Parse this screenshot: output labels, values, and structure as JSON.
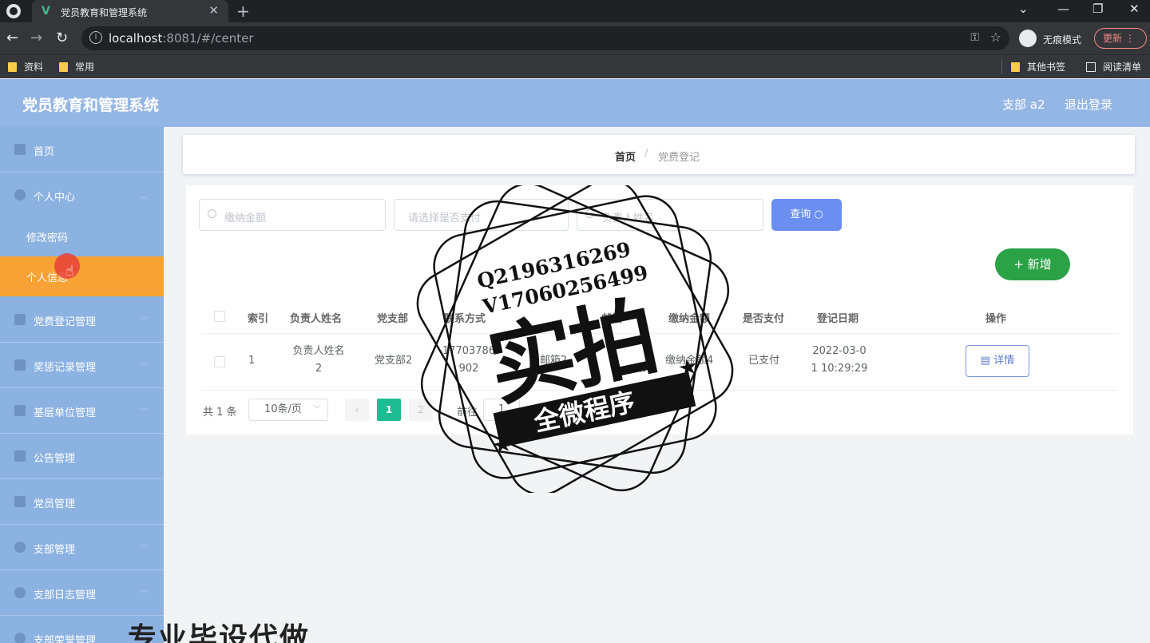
{
  "browser": {
    "tab_title": "党员教育和管理系统",
    "tab_icon": "V",
    "url_host": "localhost",
    "url_rest": ":8081/#/center",
    "incognito_label": "无痕模式",
    "update_label": "更新",
    "bookmarks": [
      "资料",
      "常用"
    ],
    "other_bookmarks": "其他书签",
    "reading_list": "阅读清单"
  },
  "header": {
    "title": "党员教育和管理系统",
    "user": "支部 a2",
    "logout": "退出登录"
  },
  "sidebar": {
    "items": [
      {
        "label": "首页"
      },
      {
        "label": "个人中心"
      },
      {
        "label": "修改密码"
      },
      {
        "label": "个人信息"
      },
      {
        "label": "党费登记管理"
      },
      {
        "label": "奖惩记录管理"
      },
      {
        "label": "基层单位管理"
      },
      {
        "label": "公告管理"
      },
      {
        "label": "党员管理"
      },
      {
        "label": "支部管理"
      },
      {
        "label": "支部日志管理"
      },
      {
        "label": "支部荣誉管理"
      }
    ]
  },
  "breadcrumb": {
    "home": "首页",
    "separator": "/",
    "current": "党费登记"
  },
  "search": {
    "amount_placeholder": "缴纳金额",
    "paid_placeholder": "请选择是否支付",
    "name_placeholder": "负责人姓名",
    "query_label": "查询"
  },
  "actions": {
    "add_label": "新增"
  },
  "table": {
    "headers": [
      "索引",
      "负责人姓名",
      "党支部",
      "联系方式",
      "邮箱",
      "缴纳金额",
      "是否支付",
      "登记日期",
      "操作"
    ],
    "rows": [
      {
        "index": "1",
        "name_line1": "负责人姓名",
        "name_line2": "2",
        "branch": "党支部2",
        "phone_line1": "17703786",
        "phone_line2": "902",
        "email_line1": "邮箱2",
        "email_line2": "m",
        "amount": "缴纳金额4",
        "paid": "已支付",
        "date_line1": "2022-03-0",
        "date_line2": "1 10:29:29",
        "detail_label": "详情"
      }
    ]
  },
  "pagination": {
    "total": "共 1 条",
    "page_size": "10条/页",
    "current_page": "1",
    "next_page": "2",
    "goto_label": "前往",
    "goto_value": "1"
  },
  "watermark": {
    "line1": "Q2196316269",
    "line2": "V17060256499",
    "big": "实拍",
    "ribbon": "全微程序",
    "bottom": "专业毕设代做"
  },
  "colors": {
    "header_bg": "#94b6e4",
    "sidebar_bg": "#8cb2e2",
    "active_item": "#f7a234",
    "query_btn": "#6a8ff0",
    "add_btn": "#2ba245",
    "page_active": "#1fbc94"
  }
}
